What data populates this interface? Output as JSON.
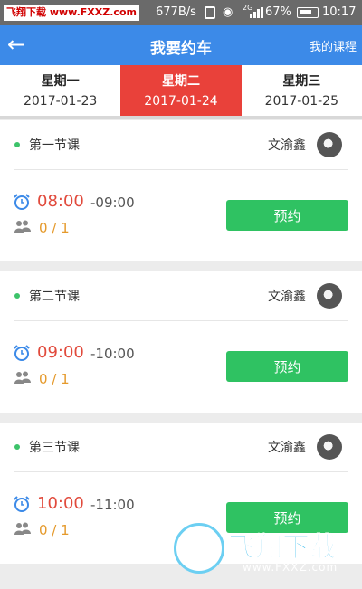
{
  "status_bar": {
    "watermark": "飞翔下载 www.FXXZ.com",
    "network_speed": "677B/s",
    "signal_type": "2G",
    "battery": "67%",
    "time": "10:17"
  },
  "header": {
    "title": "我要约车",
    "my_courses": "我的课程"
  },
  "days": [
    {
      "weekday": "星期一",
      "date": "2017-01-23",
      "selected": false
    },
    {
      "weekday": "星期二",
      "date": "2017-01-24",
      "selected": true
    },
    {
      "weekday": "星期三",
      "date": "2017-01-25",
      "selected": false
    }
  ],
  "lessons": [
    {
      "name": "第一节课",
      "teacher": "文渝鑫",
      "start": "08:00",
      "end": "-09:00",
      "count": "0 / 1",
      "button": "预约"
    },
    {
      "name": "第二节课",
      "teacher": "文渝鑫",
      "start": "09:00",
      "end": "-10:00",
      "count": "0 / 1",
      "button": "预约"
    },
    {
      "name": "第三节课",
      "teacher": "文渝鑫",
      "start": "10:00",
      "end": "-11:00",
      "count": "0 / 1",
      "button": "预约"
    }
  ],
  "overlay_watermark": {
    "text": "飞翔下载",
    "url": "www.FXXZ.com"
  },
  "colors": {
    "header": "#3c8ae8",
    "selected_day": "#e9413a",
    "book_button": "#2fc262",
    "start_time": "#e14a3c",
    "count": "#e59a2c"
  },
  "icons": [
    "back-arrow-icon",
    "wifi-icon",
    "battery-icon",
    "alarm-clock-icon",
    "people-icon",
    "avatar-icon"
  ]
}
